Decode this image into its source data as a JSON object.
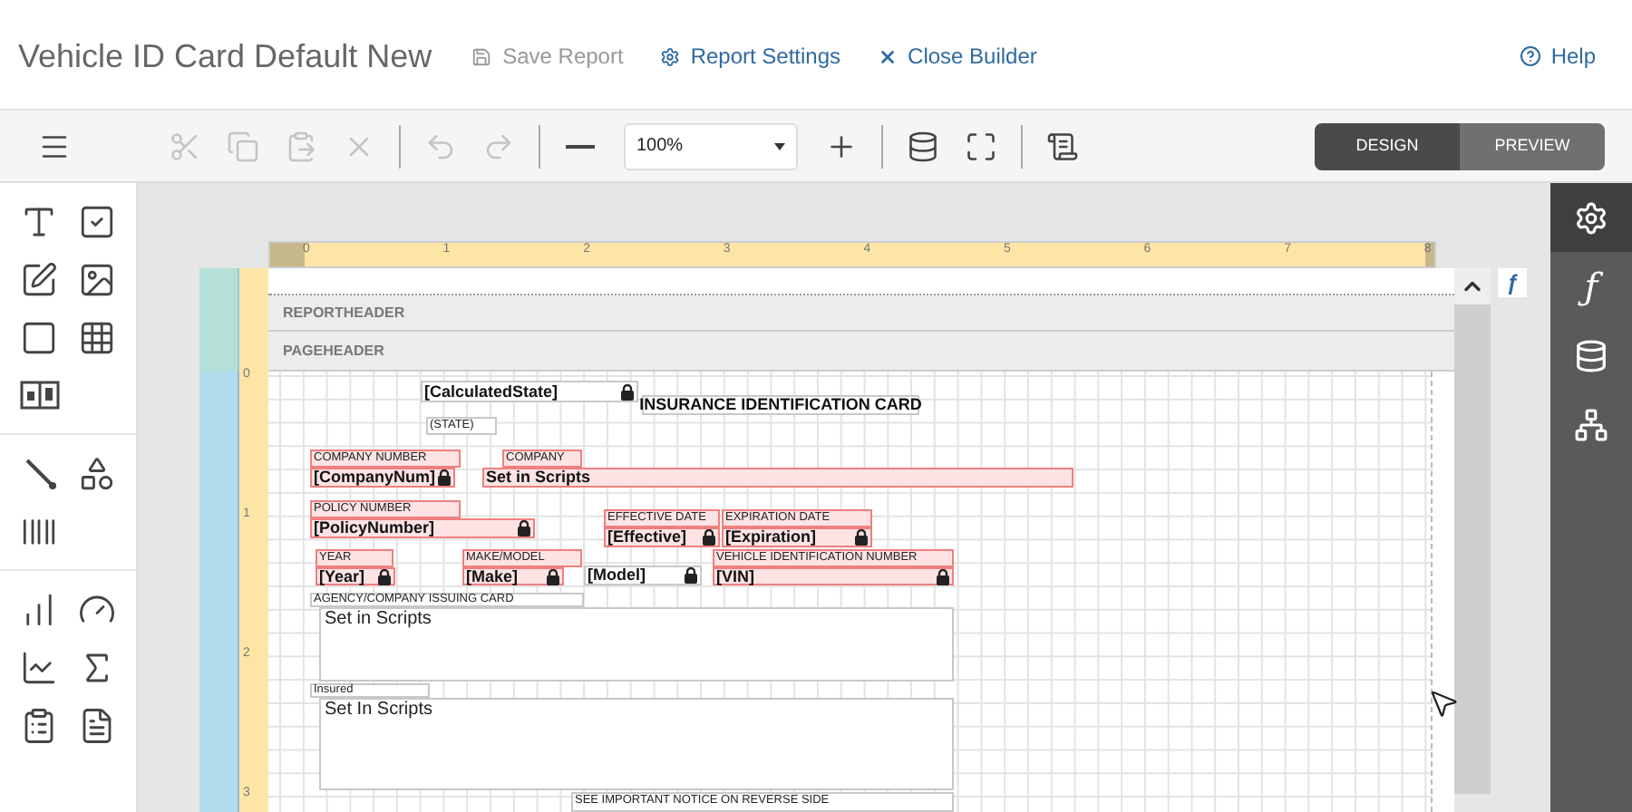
{
  "header": {
    "title": "Vehicle ID Card Default New",
    "actions": [
      {
        "label": "Save Report",
        "kind": "save",
        "disabled": true
      },
      {
        "label": "Report Settings",
        "kind": "settings",
        "disabled": false
      },
      {
        "label": "Close Builder",
        "kind": "close",
        "disabled": false
      }
    ],
    "help": "Help"
  },
  "toolbar": {
    "tools": [
      {
        "kind": "menu",
        "disabled": false
      },
      {
        "kind": "cut",
        "disabled": true
      },
      {
        "kind": "copy",
        "disabled": true
      },
      {
        "kind": "paste",
        "disabled": true
      },
      {
        "kind": "delete",
        "disabled": true
      },
      {
        "kind": "undo",
        "disabled": true
      },
      {
        "kind": "redo",
        "disabled": true
      },
      {
        "kind": "zoom-out",
        "disabled": false
      },
      {
        "kind": "zoom-field",
        "value": "100%"
      },
      {
        "kind": "zoom-in",
        "disabled": false
      },
      {
        "kind": "data-check",
        "disabled": false
      },
      {
        "kind": "fit",
        "disabled": false
      },
      {
        "kind": "script",
        "disabled": false
      }
    ],
    "view_tabs": [
      {
        "label": "DESIGN",
        "selected": true
      },
      {
        "label": "PREVIEW",
        "selected": false
      }
    ]
  },
  "toolbox": [
    [
      {
        "kind": "text"
      },
      {
        "kind": "checkbox"
      },
      {
        "kind": "edit"
      },
      {
        "kind": "image"
      },
      {
        "kind": "rectangle"
      },
      {
        "kind": "table"
      },
      {
        "kind": "two-box"
      }
    ],
    [
      {
        "kind": "line"
      },
      {
        "kind": "shapes"
      },
      {
        "kind": "barcode"
      }
    ],
    [
      {
        "kind": "bar-chart"
      },
      {
        "kind": "gauge"
      },
      {
        "kind": "line-chart"
      },
      {
        "kind": "sum"
      },
      {
        "kind": "clipboard"
      },
      {
        "kind": "pdf"
      }
    ]
  ],
  "ruler": {
    "horizontal": [
      "0",
      "1",
      "2",
      "3",
      "4",
      "5",
      "6",
      "7",
      "8"
    ],
    "vertical": [
      "0",
      "1",
      "2",
      "3"
    ]
  },
  "bands": [
    "REPORTHEADER",
    "PAGEHEADER"
  ],
  "function_button": "ƒ",
  "right_panel": [
    {
      "kind": "settings",
      "selected": true
    },
    {
      "kind": "function",
      "symbol": "ƒ",
      "selected": false
    },
    {
      "kind": "data",
      "selected": false
    },
    {
      "kind": "tree",
      "selected": false
    }
  ],
  "items": [
    {
      "kind": "field",
      "text": "[CalculatedState]",
      "locked": true,
      "flagged": false
    },
    {
      "kind": "title",
      "text": "INSURANCE IDENTIFICATION CARD",
      "locked": false,
      "flagged": false
    },
    {
      "kind": "label",
      "text": "(STATE)",
      "locked": false,
      "flagged": false
    },
    {
      "kind": "label",
      "text": "COMPANY NUMBER",
      "locked": false,
      "flagged": true
    },
    {
      "kind": "field",
      "text": "[CompanyNum]",
      "locked": true,
      "flagged": true
    },
    {
      "kind": "label",
      "text": "COMPANY",
      "locked": false,
      "flagged": true
    },
    {
      "kind": "field",
      "text": "Set in Scripts",
      "locked": false,
      "flagged": true
    },
    {
      "kind": "label",
      "text": "POLICY NUMBER",
      "locked": false,
      "flagged": true
    },
    {
      "kind": "field",
      "text": "[PolicyNumber]",
      "locked": true,
      "flagged": true
    },
    {
      "kind": "label",
      "text": "EFFECTIVE DATE",
      "locked": false,
      "flagged": true
    },
    {
      "kind": "field",
      "text": "[Effective]",
      "locked": true,
      "flagged": true
    },
    {
      "kind": "label",
      "text": "EXPIRATION DATE",
      "locked": false,
      "flagged": true
    },
    {
      "kind": "field",
      "text": "[Expiration]",
      "locked": true,
      "flagged": true
    },
    {
      "kind": "label",
      "text": "YEAR",
      "locked": false,
      "flagged": true
    },
    {
      "kind": "field",
      "text": "[Year]",
      "locked": true,
      "flagged": true
    },
    {
      "kind": "label",
      "text": "MAKE/MODEL",
      "locked": false,
      "flagged": true
    },
    {
      "kind": "field",
      "text": "[Make]",
      "locked": true,
      "flagged": true
    },
    {
      "kind": "field",
      "text": "[Model]",
      "locked": true,
      "flagged": false
    },
    {
      "kind": "label",
      "text": "VEHICLE IDENTIFICATION NUMBER",
      "locked": false,
      "flagged": true
    },
    {
      "kind": "field",
      "text": "[VIN]",
      "locked": true,
      "flagged": true
    },
    {
      "kind": "label",
      "text": "AGENCY/COMPANY ISSUING CARD",
      "locked": false,
      "flagged": false
    },
    {
      "kind": "box",
      "text": "Set in Scripts",
      "locked": false,
      "flagged": false
    },
    {
      "kind": "label",
      "text": "Insured",
      "locked": false,
      "flagged": false
    },
    {
      "kind": "box",
      "text": "Set In Scripts",
      "locked": false,
      "flagged": false
    },
    {
      "kind": "label",
      "text": "SEE IMPORTANT NOTICE ON REVERSE SIDE",
      "locked": false,
      "flagged": false
    }
  ]
}
